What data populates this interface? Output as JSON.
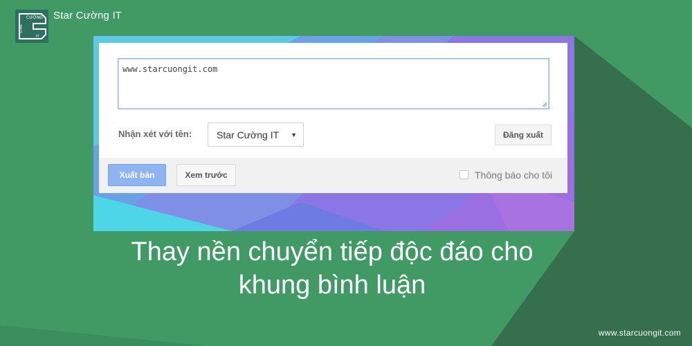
{
  "brand": {
    "name": "Star Cường IT",
    "logo_text": [
      "STAR",
      "CƯỜNG",
      "IT"
    ],
    "logo_icon": "star-cuong-logo-icon"
  },
  "comment_form": {
    "comment_value": "www.starcuongit.com",
    "name_label": "Nhận xét với tên:",
    "name_select_value": "Star Cường IT",
    "sign_out_label": "Đăng xuất",
    "publish_label": "Xuất bản",
    "preview_label": "Xem trước",
    "notify_label": "Thông báo cho tôi",
    "notify_checked": false
  },
  "headline": {
    "line1": "Thay nền chuyển tiếp độc đáo cho",
    "line2": "khung bình luận"
  },
  "footer": {
    "url": "www.starcuongit.com"
  },
  "colors": {
    "background": "#3f9a64",
    "shadow": "#356f4c",
    "publish_button": "#8fb4f2"
  }
}
